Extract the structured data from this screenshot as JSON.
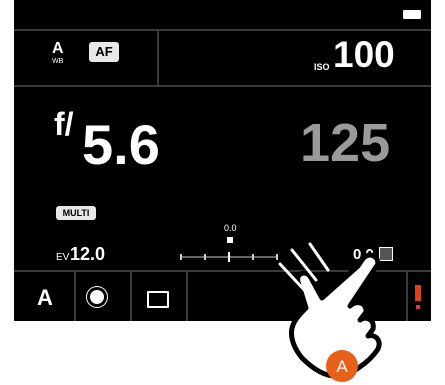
{
  "top_bar": {
    "white_balance": "A",
    "white_balance_sub": "WB",
    "focus_mode": "AF",
    "iso_label": "ISO",
    "iso_value": "100"
  },
  "exposure": {
    "aperture_prefix": "f/",
    "aperture_value": "5.6",
    "shutter_value": "125"
  },
  "metering_badge": "MULTI",
  "meter": {
    "ev_label": "EV",
    "ev_value": "12.0",
    "scale_value": "0.0",
    "compensation_value": "0.0"
  },
  "bottom_bar": {
    "mode": "A"
  },
  "annotation": {
    "marker_label": "A",
    "marker_color": "#e8611a"
  }
}
